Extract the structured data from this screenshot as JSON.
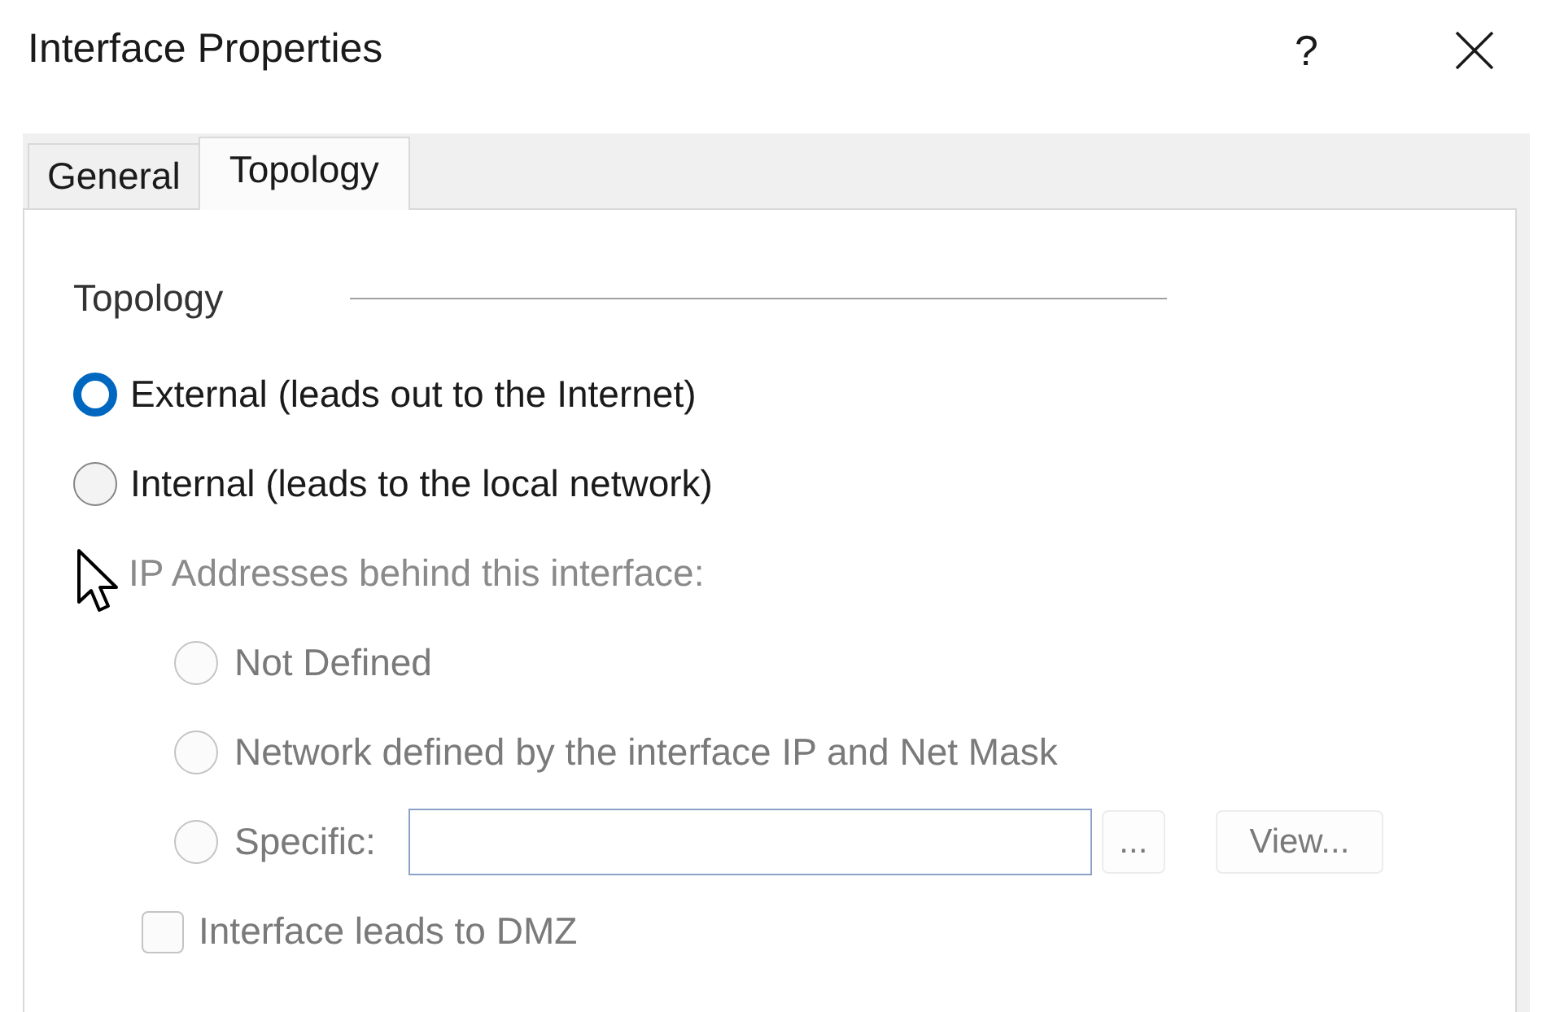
{
  "window": {
    "title": "Interface Properties",
    "help_button": "?"
  },
  "tabs": [
    {
      "label": "General",
      "selected": false
    },
    {
      "label": "Topology",
      "selected": true
    }
  ],
  "topology": {
    "title": "Topology",
    "options": [
      {
        "label": "External (leads out to the Internet)",
        "selected": true
      },
      {
        "label": "Internal (leads to the local network)",
        "selected": false
      }
    ]
  },
  "ip_addresses": {
    "label": "IP Addresses behind this interface:",
    "disabled": true,
    "options": [
      {
        "kind": "plain",
        "label": "Not Defined",
        "selected": false
      },
      {
        "kind": "plain",
        "label": "Network defined by the interface IP and Net Mask",
        "selected": false
      },
      {
        "kind": "specific",
        "label": "Specific:",
        "selected": false,
        "browse_button": "...",
        "view_button": "View..."
      }
    ]
  },
  "dmz": {
    "label": "Interface leads to DMZ",
    "checked": false,
    "disabled": true
  }
}
